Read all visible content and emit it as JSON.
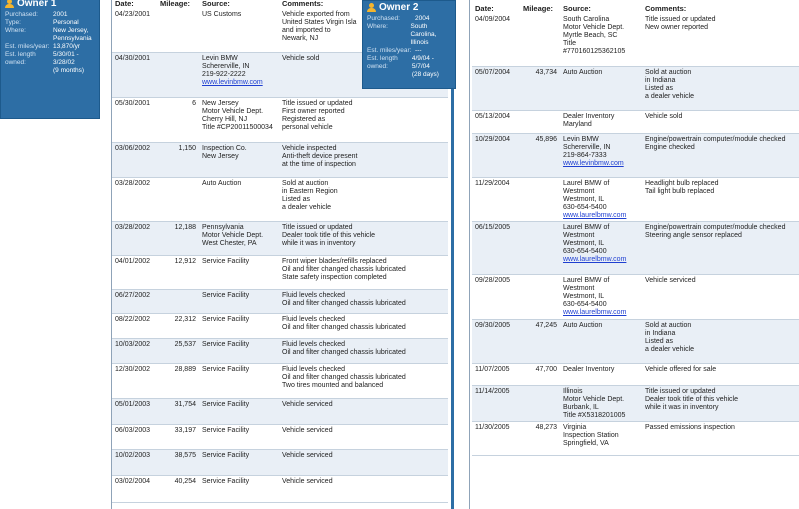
{
  "owner1": {
    "title": "Owner 1",
    "fields": [
      {
        "k": "Purchased:",
        "v": [
          "2001"
        ]
      },
      {
        "k": "Type:",
        "v": [
          "Personal"
        ]
      },
      {
        "k": "Where:",
        "v": [
          "New Jersey,",
          "Pennsylvania"
        ]
      },
      {
        "k": "Est. miles/year:",
        "v": [
          "13,870/yr"
        ]
      },
      {
        "k": "Est. length owned:",
        "v": [
          "5/30/01 -",
          "3/28/02",
          "(9 months)"
        ]
      }
    ]
  },
  "owner2": {
    "title": "Owner 2",
    "fields": [
      {
        "k": "Purchased:",
        "v": [
          "2004"
        ]
      },
      {
        "k": "Where:",
        "v": [
          "South Carolina,",
          "Illinois"
        ]
      },
      {
        "k": "Est. miles/year:",
        "v": [
          "---"
        ]
      },
      {
        "k": "Est. length owned:",
        "v": [
          "4/9/04 - 5/7/04",
          "(28 days)"
        ]
      }
    ]
  },
  "headers": {
    "date": "Date:",
    "mileage": "Mileage:",
    "source": "Source:",
    "comments": "Comments:"
  },
  "left_records": [
    {
      "date": "04/23/2001",
      "mileage": "",
      "source": [
        "US Customs"
      ],
      "link": "",
      "comments": [
        "Vehicle exported from",
        "United States Virgin Isla",
        "and imported to",
        "Newark, NJ"
      ]
    },
    {
      "date": "04/30/2001",
      "mileage": "",
      "source": [
        "Levin BMW",
        "Schererville, IN",
        "219-922-2222"
      ],
      "link": "www.levinbmw.com",
      "comments": [
        "Vehicle sold"
      ]
    },
    {
      "date": "05/30/2001",
      "mileage": "6",
      "source": [
        "New Jersey",
        "Motor Vehicle Dept.",
        "Cherry Hill, NJ",
        "Title #CP20011500034"
      ],
      "link": "",
      "comments": [
        "Title issued or updated",
        "First owner reported",
        "Registered as",
        "personal vehicle"
      ]
    },
    {
      "date": "03/06/2002",
      "mileage": "1,150",
      "source": [
        "Inspection Co.",
        "New Jersey"
      ],
      "link": "",
      "comments": [
        "Vehicle inspected",
        "Anti-theft device present",
        "at the time of inspection"
      ]
    },
    {
      "date": "03/28/2002",
      "mileage": "",
      "source": [
        "Auto Auction"
      ],
      "link": "",
      "comments": [
        "Sold at auction",
        "in Eastern Region",
        "Listed as",
        "a dealer vehicle"
      ]
    },
    {
      "date": "03/28/2002",
      "mileage": "12,188",
      "source": [
        "Pennsylvania",
        "Motor Vehicle Dept.",
        "West Chester, PA"
      ],
      "link": "",
      "comments": [
        "Title issued or updated",
        "Dealer took title of this vehicle",
        "while it was in inventory"
      ]
    },
    {
      "date": "04/01/2002",
      "mileage": "12,912",
      "source": [
        "Service Facility"
      ],
      "link": "",
      "comments": [
        "Front wiper blades/refills replaced",
        "Oil and filter changed chassis lubricated",
        "State safety inspection completed"
      ]
    },
    {
      "date": "06/27/2002",
      "mileage": "",
      "source": [
        "Service Facility"
      ],
      "link": "",
      "comments": [
        "Fluid levels checked",
        "Oil and filter changed chassis lubricated"
      ]
    },
    {
      "date": "08/22/2002",
      "mileage": "22,312",
      "source": [
        "Service Facility"
      ],
      "link": "",
      "comments": [
        "Fluid levels checked",
        "Oil and filter changed chassis lubricated"
      ]
    },
    {
      "date": "10/03/2002",
      "mileage": "25,537",
      "source": [
        "Service Facility"
      ],
      "link": "",
      "comments": [
        "Fluid levels checked",
        "Oil and filter changed chassis lubricated"
      ]
    },
    {
      "date": "12/30/2002",
      "mileage": "28,889",
      "source": [
        "Service Facility"
      ],
      "link": "",
      "comments": [
        "Fluid levels checked",
        "Oil and filter changed chassis lubricated",
        "Two tires mounted and balanced"
      ]
    },
    {
      "date": "05/01/2003",
      "mileage": "31,754",
      "source": [
        "Service Facility"
      ],
      "link": "",
      "comments": [
        "Vehicle serviced"
      ]
    },
    {
      "date": "06/03/2003",
      "mileage": "33,197",
      "source": [
        "Service Facility"
      ],
      "link": "",
      "comments": [
        "Vehicle serviced"
      ]
    },
    {
      "date": "10/02/2003",
      "mileage": "38,575",
      "source": [
        "Service Facility"
      ],
      "link": "",
      "comments": [
        "Vehicle serviced"
      ]
    },
    {
      "date": "03/02/2004",
      "mileage": "40,254",
      "source": [
        "Service Facility"
      ],
      "link": "",
      "comments": [
        "Vehicle serviced"
      ]
    }
  ],
  "right_records": [
    {
      "date": "04/09/2004",
      "mileage": "",
      "source": [
        "South Carolina",
        "Motor Vehicle Dept.",
        "Myrtle Beach, SC",
        "Title",
        "#770160125362105"
      ],
      "link": "",
      "comments": [
        "Title issued or updated",
        "New owner reported"
      ]
    },
    {
      "date": "05/07/2004",
      "mileage": "43,734",
      "source": [
        "Auto Auction"
      ],
      "link": "",
      "comments": [
        "Sold at auction",
        "in Indiana",
        "Listed as",
        "a dealer vehicle"
      ]
    },
    {
      "date": "05/13/2004",
      "mileage": "",
      "source": [
        "Dealer Inventory",
        "Maryland"
      ],
      "link": "",
      "comments": [
        "Vehicle sold"
      ]
    },
    {
      "date": "10/29/2004",
      "mileage": "45,896",
      "source": [
        "Levin BMW",
        "Schererville, IN",
        "219-864-7333"
      ],
      "link": "www.levinbmw.com",
      "comments": [
        "Engine/powertrain computer/module checked",
        "Engine checked"
      ]
    },
    {
      "date": "11/29/2004",
      "mileage": "",
      "source": [
        "Laurel BMW of",
        "Westmont",
        "Westmont, IL",
        "630-654-5400"
      ],
      "link": "www.laurelbmw.com",
      "comments": [
        "Headlight bulb replaced",
        "Tail light bulb replaced"
      ]
    },
    {
      "date": "06/15/2005",
      "mileage": "",
      "source": [
        "Laurel BMW of",
        "Westmont",
        "Westmont, IL",
        "630-654-5400"
      ],
      "link": "www.laurelbmw.com",
      "comments": [
        "Engine/powertrain computer/module checked",
        "Steering angle sensor replaced"
      ]
    },
    {
      "date": "09/28/2005",
      "mileage": "",
      "source": [
        "Laurel BMW of",
        "Westmont",
        "Westmont, IL",
        "630-654-5400"
      ],
      "link": "www.laurelbmw.com",
      "comments": [
        "Vehicle serviced"
      ]
    },
    {
      "date": "09/30/2005",
      "mileage": "47,245",
      "source": [
        "Auto Auction"
      ],
      "link": "",
      "comments": [
        "Sold at auction",
        "in Indiana",
        "Listed as",
        "a dealer vehicle"
      ]
    },
    {
      "date": "11/07/2005",
      "mileage": "47,700",
      "source": [
        "Dealer Inventory"
      ],
      "link": "",
      "comments": [
        "Vehicle offered for sale"
      ]
    },
    {
      "date": "11/14/2005",
      "mileage": "",
      "source": [
        "Illinois",
        "Motor Vehicle Dept.",
        "Burbank, IL",
        "Title #X5318201005"
      ],
      "link": "",
      "comments": [
        "Title issued or updated",
        "Dealer took title of this vehicle",
        "while it was in inventory"
      ]
    },
    {
      "date": "11/30/2005",
      "mileage": "48,273",
      "source": [
        "Virginia",
        "Inspection Station",
        "Springfield, VA"
      ],
      "link": "",
      "comments": [
        "Passed emissions inspection"
      ]
    }
  ]
}
